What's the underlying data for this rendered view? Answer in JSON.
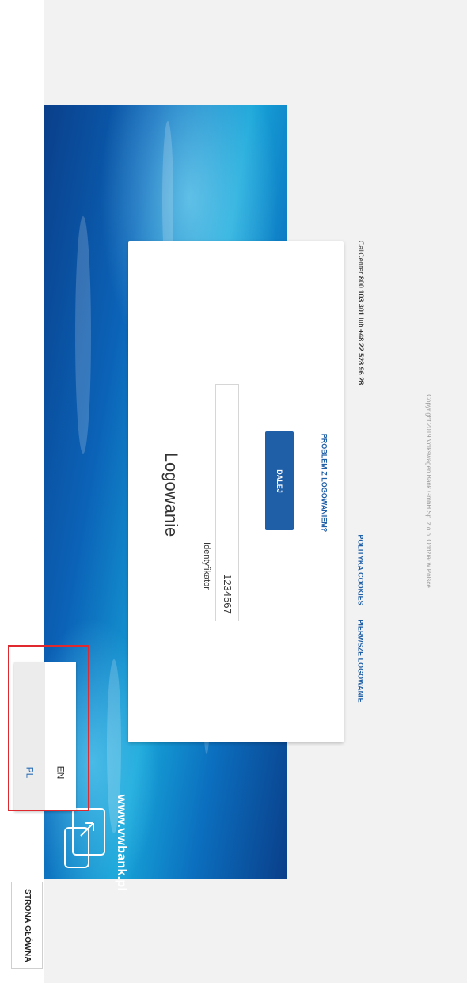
{
  "nav": {
    "home_label": "STRONA GŁÓWNA"
  },
  "language": {
    "options": [
      "PL",
      "EN"
    ],
    "selected": "PL"
  },
  "brand": {
    "site": "www.vwbank.pl"
  },
  "login": {
    "title": "Logowanie",
    "field_label": "Identyfikator",
    "field_value": "1234567",
    "next_label": "DALEJ",
    "problem_label": "PROBLEM Z LOGOWANIEM?"
  },
  "footer": {
    "first_login": "PIERWSZE LOGOWANIE",
    "cookies": "POLITYKA COOKIES",
    "callcenter_prefix": "CallCenter ",
    "phone1": "800 103 301",
    "phone_sep": " lub ",
    "phone2": "+48 22 528 96 28",
    "copyright": "Copyright 2019 Volkswagen Bank GmbH Sp. z o.o. Oddział w Polsce"
  },
  "colors": {
    "accent": "#1f5fa8",
    "highlight": "#e0282f"
  }
}
